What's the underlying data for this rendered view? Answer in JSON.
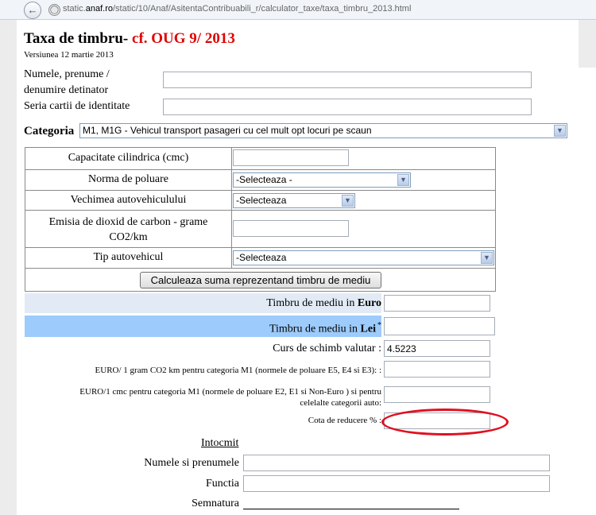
{
  "browser": {
    "url_prefix": "static.",
    "url_domain": "anaf.ro",
    "url_path": "/static/10/Anaf/AsitentaContribuabili_r/calculator_taxe/taxa_timbru_2013.html"
  },
  "header": {
    "title_main": "Taxa de timbru-",
    "title_ref": " cf. OUG 9/ 2013",
    "version": "Versiunea 12 martie 2013"
  },
  "owner": {
    "name_label_line1": "Numele, prenume /",
    "name_label_line2": "denumire detinator",
    "name_value": "",
    "id_label": "Seria cartii de identitate",
    "id_value": ""
  },
  "categoria": {
    "label": "Categoria",
    "selected": "M1, M1G - Vehicul transport pasageri cu cel mult opt locuri pe scaun"
  },
  "form": {
    "capacitate_label": "Capacitate cilindrica (cmc)",
    "capacitate_value": "",
    "norma_label": "Norma de poluare",
    "norma_selected": "-Selecteaza -",
    "vechime_label": "Vechimea autovehiculului",
    "vechime_selected": "-Selecteaza",
    "emisia_label_line1": "Emisia de dioxid de carbon  - grame",
    "emisia_label_line2": "CO2/km",
    "emisia_value": "",
    "tip_label": "Tip autovehicul",
    "tip_selected": "-Selecteaza",
    "calc_button": "Calculeaza suma reprezentand timbru de mediu"
  },
  "results": {
    "euro_label": "Timbru de mediu in ",
    "euro_bold": "Euro",
    "euro_value": "",
    "lei_label": "Timbru de mediu in ",
    "lei_bold": "Lei",
    "lei_star": "*",
    "lei_value": "",
    "curs_label": "Curs de schimb valutar :",
    "curs_value": "4.5223",
    "co2_rate_label": "EURO/ 1 gram CO2 km pentru categoria M1 (normele de poluare E5, E4 si E3): :",
    "co2_rate_value": "",
    "cmc_rate_label_line1": "EURO/1 cmc pentru categoria M1 (normele de poluare E2, E1 si Non-Euro ) si pentru",
    "cmc_rate_label_line2": "celelalte categorii auto:",
    "cmc_rate_value": "",
    "cota_label": "Cota de reducere % :",
    "cota_value": ""
  },
  "intocmit": {
    "heading": "Intocmit",
    "name_label": "Numele si prenumele",
    "name_value": "",
    "functia_label": "Functia",
    "functia_value": "",
    "semnatura_label": "Semnatura"
  },
  "colors": {
    "highlight_red": "#e00000",
    "lei_row_bg": "#9dcbfb",
    "euro_row_bg": "#e2ebf5",
    "annotation_ellipse": "#e01020"
  }
}
